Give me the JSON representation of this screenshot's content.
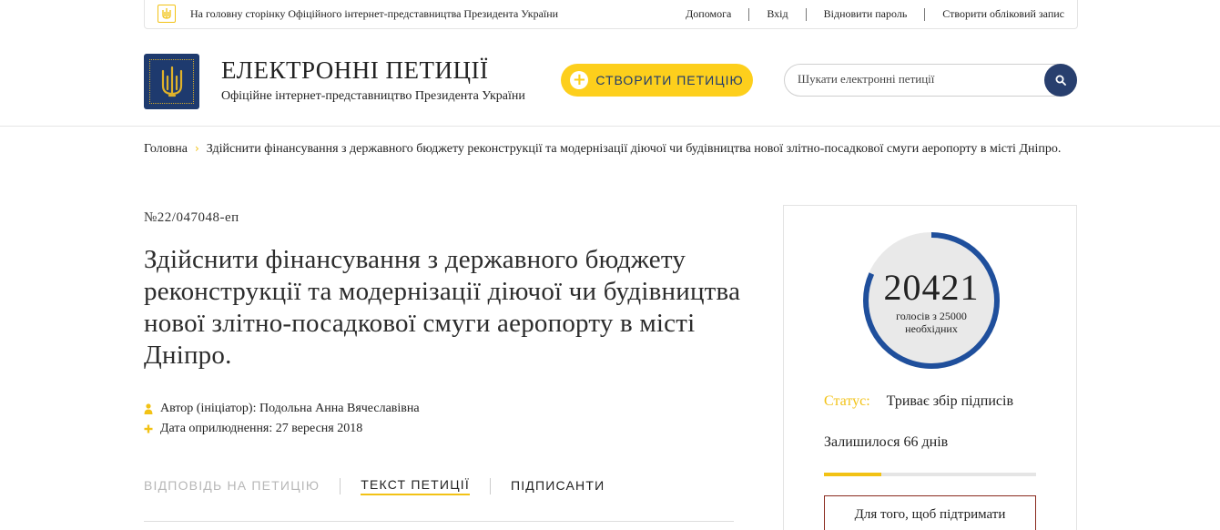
{
  "topbar": {
    "home_link": "На головну сторінку Офіційного інтернет-представництва Президента України",
    "links": [
      "Допомога",
      "Вхід",
      "Відновити пароль",
      "Створити обліковий запис"
    ]
  },
  "header": {
    "title": "ЕЛЕКТРОННІ ПЕТИЦІЇ",
    "subtitle": "Офіційне інтернет-представництво Президента України",
    "create_button": "СТВОРИТИ ПЕТИЦІЮ",
    "search_placeholder": "Шукати електронні петиції"
  },
  "breadcrumb": {
    "home": "Головна",
    "current": "Здійснити фінансування з державного бюджету реконструкції та модернізації діючої чи будівництва нової злітно-посадкової смуги аеропорту в місті Дніпро."
  },
  "petition": {
    "number": "№22/047048-еп",
    "title": "Здійснити фінансування з державного бюджету реконструкції та модернізації діючої чи будівництва нової злітно-посадкової смуги аеропорту в місті Дніпро.",
    "author": "Автор (ініціатор): Подольна Анна Вячеславівна",
    "date": "Дата оприлюднення: 27 вересня 2018"
  },
  "tabs": [
    {
      "label": "ВІДПОВІДЬ НА ПЕТИЦІЮ",
      "state": "disabled"
    },
    {
      "label": "ТЕКСТ ПЕТИЦІЇ",
      "state": "active"
    },
    {
      "label": "ПІДПИСАНТИ",
      "state": "normal"
    }
  ],
  "panel": {
    "votes": "20421",
    "votes_sub": "голосів з 25000 необхідних",
    "votes_current": 20421,
    "votes_required": 25000,
    "status_label": "Статус:",
    "status_value": "Триває збір підписів",
    "days_left": "Залишилося 66 днів",
    "time_progress": 0.27,
    "support_text": "Для того, щоб підтримати"
  },
  "colors": {
    "accent_yellow": "#fdcf1c",
    "brand_blue": "#1e3a6e",
    "gauge_blue": "#1f4f9c",
    "gauge_track": "#e8e8e8"
  },
  "icons": {
    "logo": "trident-icon",
    "search": "search-icon",
    "plus": "plus-icon",
    "author": "user-icon",
    "date": "plus-icon"
  }
}
